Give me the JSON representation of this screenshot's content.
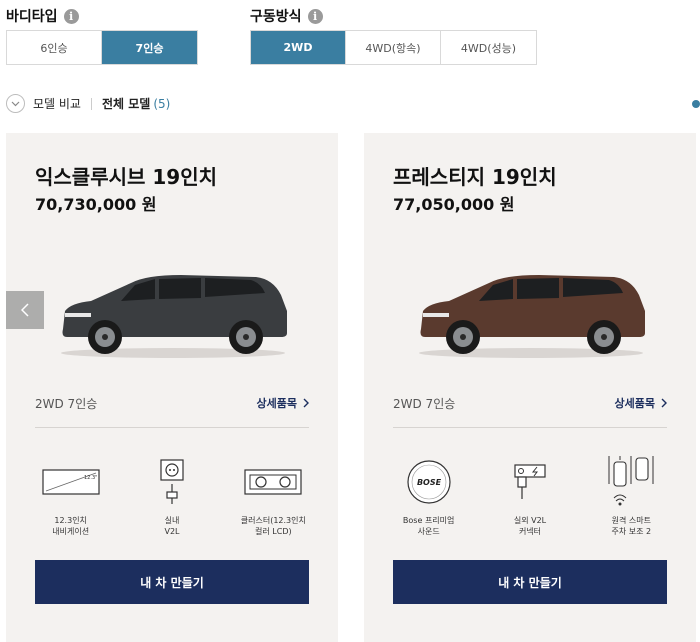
{
  "filters": {
    "body_type": {
      "label": "바디타입",
      "options": [
        "6인승",
        "7인승"
      ],
      "selected": "7인승"
    },
    "drive_type": {
      "label": "구동방식",
      "options": [
        "2WD",
        "4WD(항속)",
        "4WD(성능)"
      ],
      "selected": "2WD"
    }
  },
  "compare": {
    "label": "모델 비교",
    "all_models": "전체 모델",
    "count": "(5)"
  },
  "cards": [
    {
      "title": "익스클루시브 19인치",
      "price": "70,730,000 원",
      "car_color": "#3a3d40",
      "trim": "2WD 7인승",
      "detail_link": "상세품목",
      "features": [
        {
          "icon": "navigation-screen-icon",
          "label": "12.3인치\n내비게이션",
          "screen_text": "12.3\""
        },
        {
          "icon": "v2l-outlet-icon",
          "label": "실내\nV2L"
        },
        {
          "icon": "cluster-display-icon",
          "label": "클러스터(12.3인치\n컬러 LCD)"
        }
      ],
      "cta": "내 차 만들기"
    },
    {
      "title": "프레스티지 19인치",
      "price": "77,050,000 원",
      "car_color": "#5a3a2e",
      "trim": "2WD 7인승",
      "detail_link": "상세품목",
      "features": [
        {
          "icon": "bose-speaker-icon",
          "label": "Bose 프리미엄\n사운드",
          "logo_text": "BOSE"
        },
        {
          "icon": "v2l-connector-icon",
          "label": "실외 V2L\n커넥터"
        },
        {
          "icon": "remote-parking-icon",
          "label": "원격 스마트\n주차 보조 2"
        }
      ],
      "cta": "내 차 만들기"
    }
  ]
}
